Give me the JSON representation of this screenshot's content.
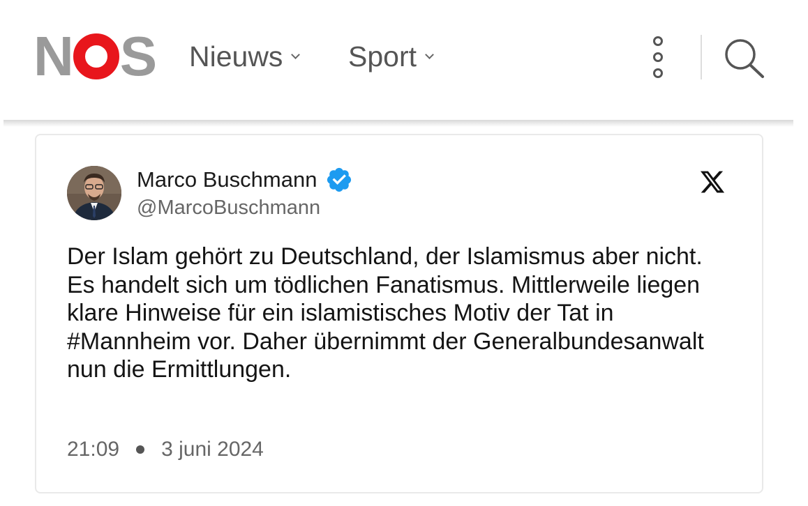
{
  "header": {
    "logo": {
      "letter_n": "N",
      "letter_o": "O",
      "letter_s": "S"
    },
    "nav": [
      {
        "label": "Nieuws"
      },
      {
        "label": "Sport"
      }
    ],
    "icons": {
      "more": "more-vertical-icon",
      "search": "search-icon"
    },
    "colors": {
      "brand_red": "#e8161c",
      "logo_gray": "#9a9a9a",
      "nav_text": "#555555"
    }
  },
  "tweet": {
    "author_name": "Marco Buschmann",
    "author_handle": "@MarcoBuschmann",
    "verified": true,
    "verified_color": "#1d9bf0",
    "source_icon": "x-logo-icon",
    "text": "Der Islam gehört zu Deutschland, der Islamismus aber nicht. Es handelt sich um tödlichen Fanatismus. Mittlerweile liegen klare Hinweise für ein islamistisches Motiv der Tat in #Mannheim vor. Daher übernimmt der Generalbundesanwalt nun die Ermittlungen.",
    "time": "21:09",
    "date": "3 juni 2024"
  }
}
